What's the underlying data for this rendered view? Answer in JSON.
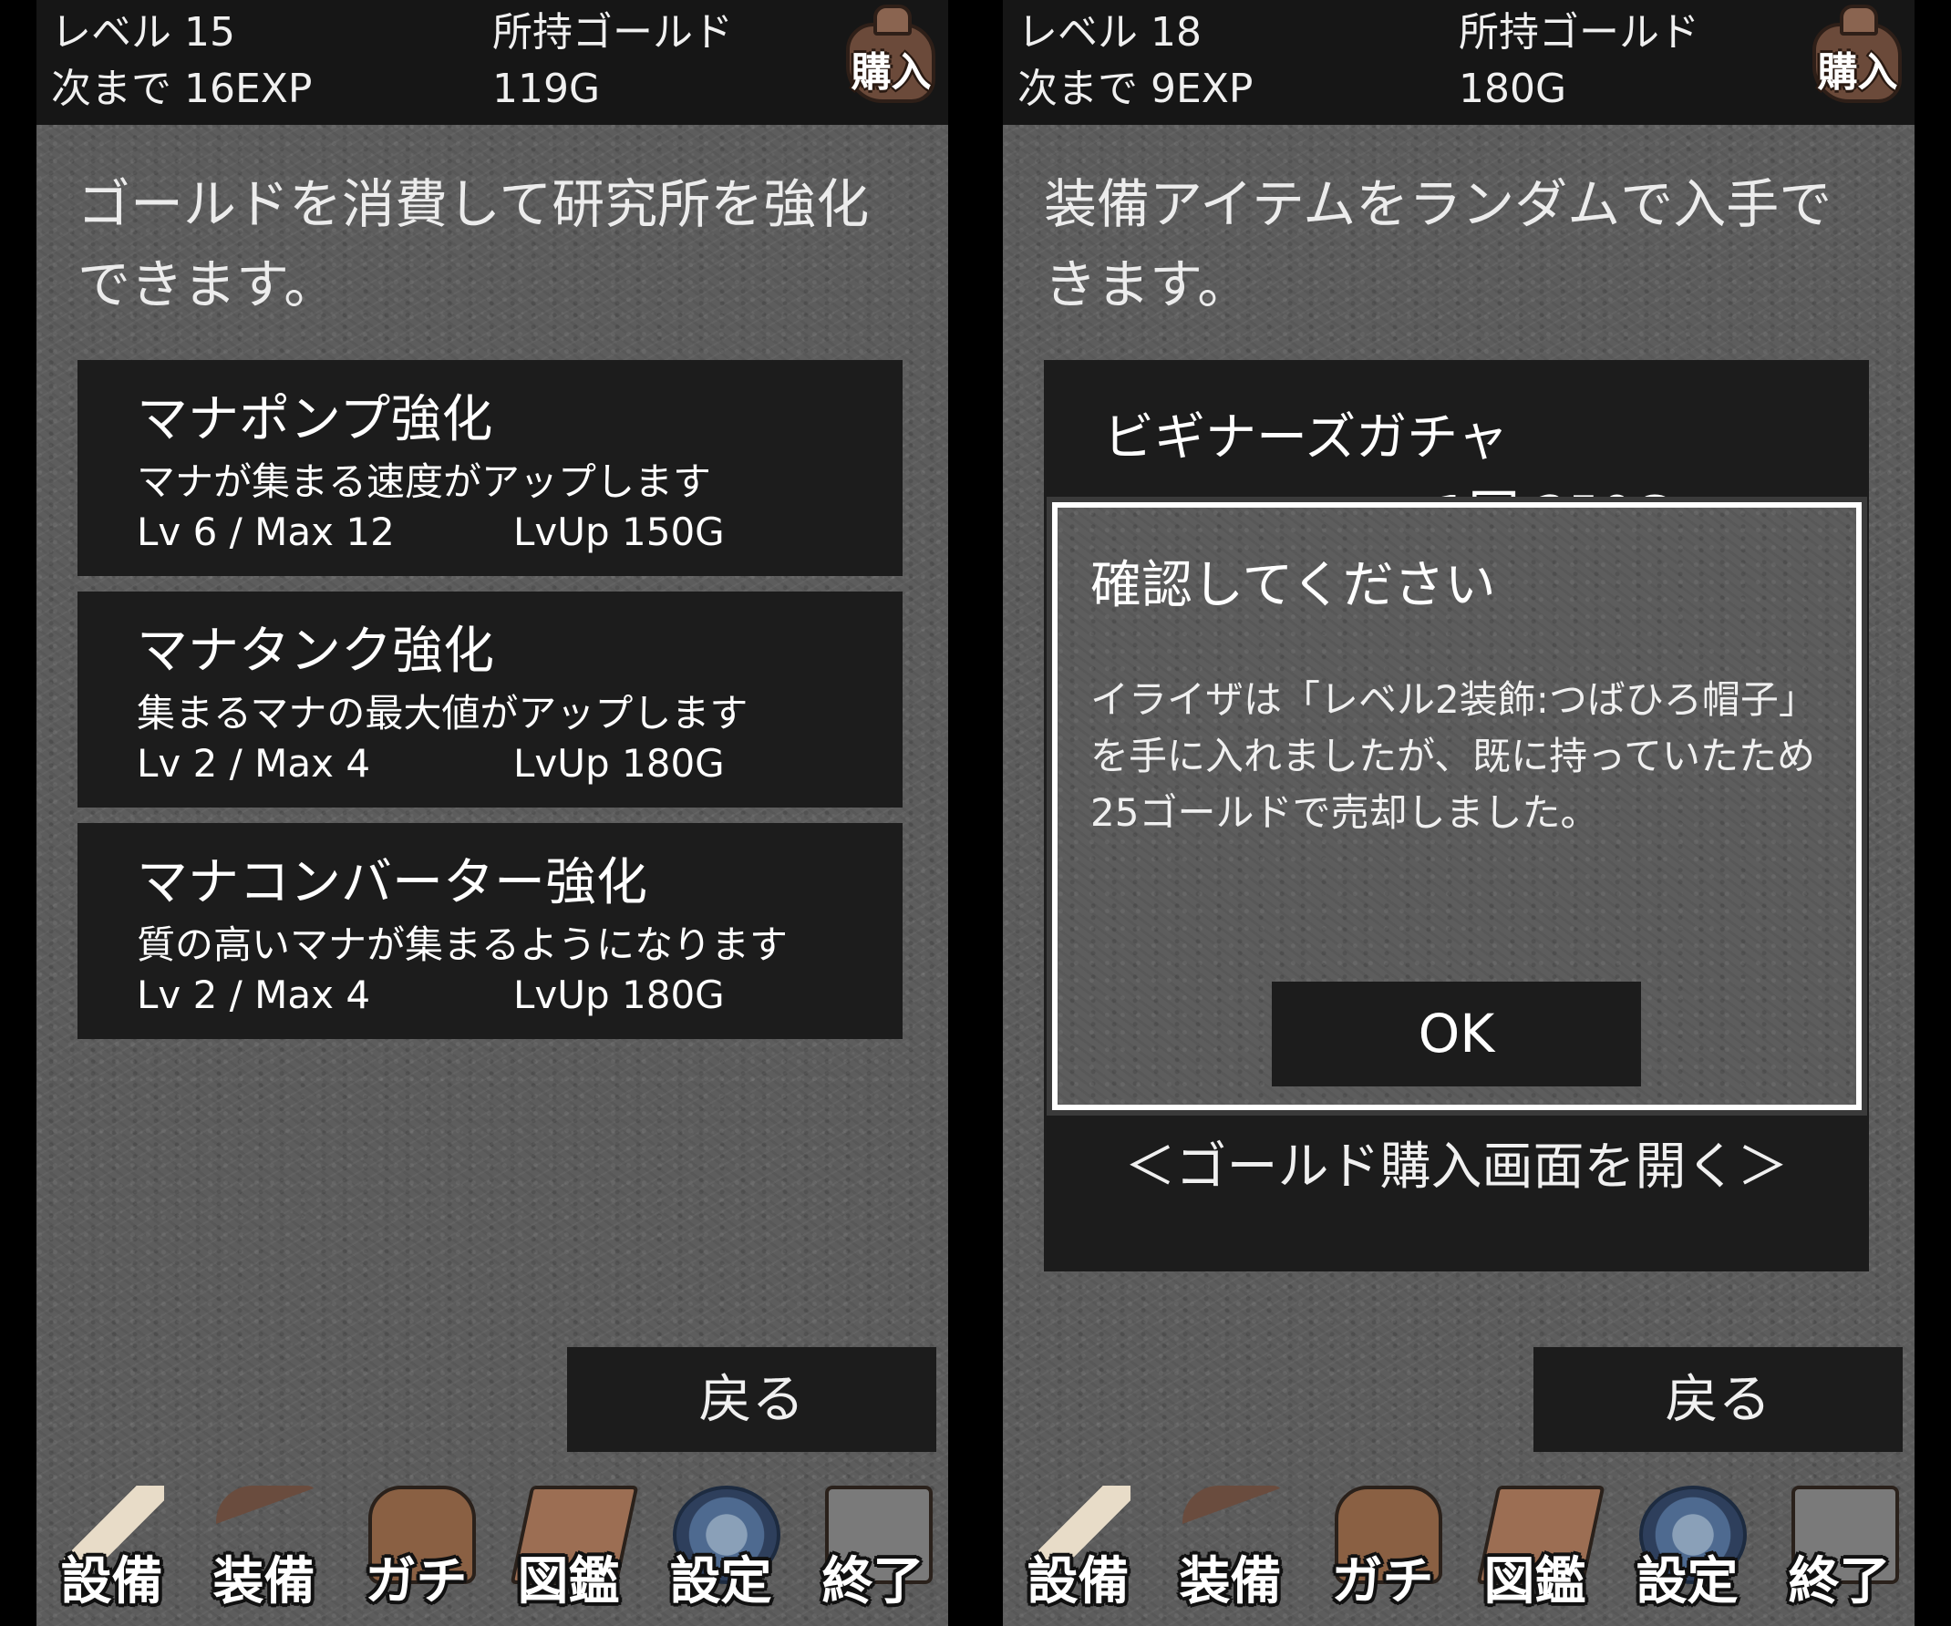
{
  "left": {
    "level": "レベル 15",
    "exp": "次まで 16EXP",
    "gold_label": "所持ゴールド",
    "gold": "119G",
    "buy": "購入",
    "description": "ゴールドを消費して研究所を強化できます。",
    "upgrades": [
      {
        "name": "マナポンプ強化",
        "desc": "マナが集まる速度がアップします",
        "level": "Lv 6 / Max 12",
        "cost": "LvUp 150G"
      },
      {
        "name": "マナタンク強化",
        "desc": "集まるマナの最大値がアップします",
        "level": "Lv 2 / Max 4",
        "cost": "LvUp 180G"
      },
      {
        "name": "マナコンバーター強化",
        "desc": "質の高いマナが集まるようになります",
        "level": "Lv 2 / Max 4",
        "cost": "LvUp 180G"
      }
    ],
    "back": "戻る"
  },
  "right": {
    "level": "レベル 18",
    "exp": "次まで 9EXP",
    "gold_label": "所持ゴールド",
    "gold": "180G",
    "buy": "購入",
    "description": "装備アイテムをランダムで入手できます。",
    "gacha_name": "ビギナーズガチャ",
    "gacha_price": "1回 250G",
    "gold_link": "＜ゴールド購入画面を開く＞",
    "back": "戻る",
    "dialog": {
      "title": "確認してください",
      "message": "イライザは「レベル2装飾:つばひろ帽子」を手に入れましたが、既に持っていたため25ゴールドで売却しました。",
      "ok": "OK"
    }
  },
  "nav": [
    {
      "label": "設備",
      "icon": "pen-icon"
    },
    {
      "label": "装備",
      "icon": "pickaxe-icon"
    },
    {
      "label": "ガチャ",
      "icon": "chest-icon"
    },
    {
      "label": "図鑑",
      "icon": "book-icon"
    },
    {
      "label": "設定",
      "icon": "gear-icon"
    },
    {
      "label": "終了",
      "icon": "door-icon"
    }
  ]
}
